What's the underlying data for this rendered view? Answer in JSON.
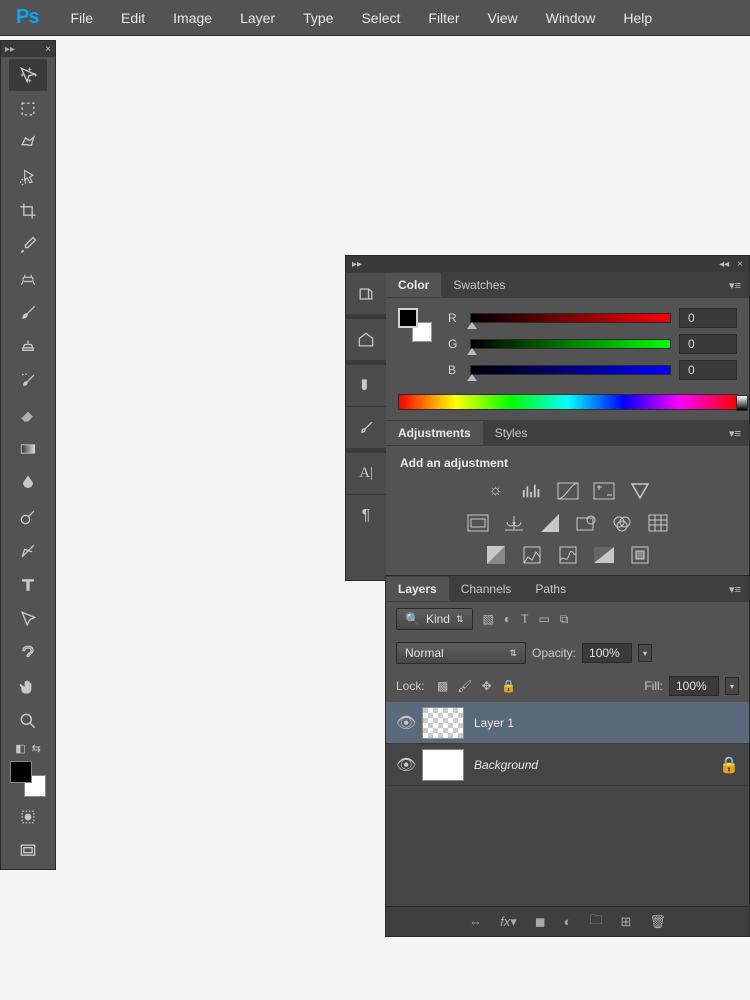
{
  "app": {
    "logo": "Ps"
  },
  "menu": [
    "File",
    "Edit",
    "Image",
    "Layer",
    "Type",
    "Select",
    "Filter",
    "View",
    "Window",
    "Help"
  ],
  "tools": [
    {
      "name": "move-tool"
    },
    {
      "name": "marquee-tool"
    },
    {
      "name": "lasso-tool"
    },
    {
      "name": "quick-select-tool"
    },
    {
      "name": "crop-tool"
    },
    {
      "name": "eyedropper-tool"
    },
    {
      "name": "healing-brush-tool"
    },
    {
      "name": "brush-tool"
    },
    {
      "name": "clone-stamp-tool"
    },
    {
      "name": "history-brush-tool"
    },
    {
      "name": "eraser-tool"
    },
    {
      "name": "gradient-tool"
    },
    {
      "name": "blur-tool"
    },
    {
      "name": "dodge-tool"
    },
    {
      "name": "pen-tool"
    },
    {
      "name": "type-tool"
    },
    {
      "name": "path-select-tool"
    },
    {
      "name": "shape-tool"
    },
    {
      "name": "hand-tool"
    },
    {
      "name": "zoom-tool"
    }
  ],
  "color_panel": {
    "tabs": [
      "Color",
      "Swatches"
    ],
    "active_tab": "Color",
    "channels": [
      {
        "label": "R",
        "value": "0"
      },
      {
        "label": "G",
        "value": "0"
      },
      {
        "label": "B",
        "value": "0"
      }
    ]
  },
  "adjustments_panel": {
    "tabs": [
      "Adjustments",
      "Styles"
    ],
    "active_tab": "Adjustments",
    "title": "Add an adjustment"
  },
  "layers_panel": {
    "tabs": [
      "Layers",
      "Channels",
      "Paths"
    ],
    "active_tab": "Layers",
    "filter_label": "Kind",
    "blend_mode": "Normal",
    "opacity_label": "Opacity:",
    "opacity_value": "100%",
    "lock_label": "Lock:",
    "fill_label": "Fill:",
    "fill_value": "100%",
    "layers": [
      {
        "name": "Layer 1",
        "visible": true,
        "selected": true,
        "transparent": true,
        "locked": false
      },
      {
        "name": "Background",
        "visible": true,
        "selected": false,
        "transparent": false,
        "locked": true,
        "italic": true
      }
    ]
  }
}
